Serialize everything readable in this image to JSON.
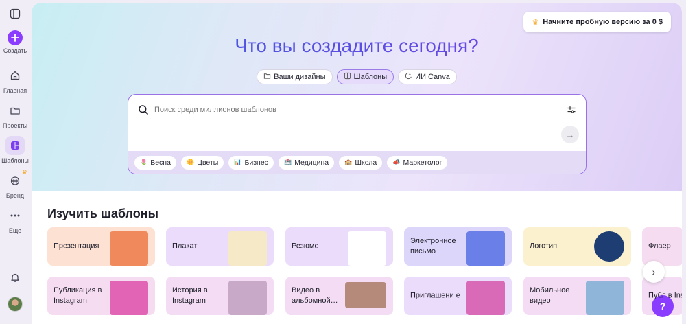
{
  "sidebar": {
    "items": [
      {
        "label": "Создать",
        "icon": "plus-icon"
      },
      {
        "label": "Главная",
        "icon": "home-icon"
      },
      {
        "label": "Проекты",
        "icon": "folder-icon"
      },
      {
        "label": "Шаблоны",
        "icon": "templates-icon"
      },
      {
        "label": "Бренд",
        "icon": "brand-icon"
      },
      {
        "label": "Еще",
        "icon": "more-icon"
      }
    ]
  },
  "header": {
    "trial_label": "Начните пробную версию за 0 $",
    "title": "Что вы создадите сегодня?",
    "tabs": [
      {
        "label": "Ваши дизайны",
        "icon": "folder-icon"
      },
      {
        "label": "Шаблоны",
        "icon": "templates-icon"
      },
      {
        "label": "ИИ Canva",
        "icon": "ai-icon"
      }
    ]
  },
  "search": {
    "placeholder": "Поиск среди миллионов шаблонов",
    "chips": [
      {
        "label": "Весна",
        "emoji": "🌷"
      },
      {
        "label": "Цветы",
        "emoji": "🌼"
      },
      {
        "label": "Бизнес",
        "emoji": "📊"
      },
      {
        "label": "Медицина",
        "emoji": "🏥"
      },
      {
        "label": "Школа",
        "emoji": "🏫"
      },
      {
        "label": "Маркетолог",
        "emoji": "📣"
      }
    ]
  },
  "templates": {
    "title": "Изучить шаблоны",
    "row1": [
      {
        "label": "Презентация",
        "bg": "#fde1d3",
        "art": "#f08a5d"
      },
      {
        "label": "Плакат",
        "bg": "#ecdcfb",
        "art": "#f5e9c8"
      },
      {
        "label": "Резюме",
        "bg": "#ecdcfb",
        "art": "#ffffff"
      },
      {
        "label": "Электронное письмо",
        "bg": "#ddd6fb",
        "art": "#6a7fe8"
      },
      {
        "label": "Логотип",
        "bg": "#fbf1cf",
        "art": "#1e3d72"
      },
      {
        "label": "Флаер",
        "bg": "#f6dcf0",
        "art": "#ffffff"
      }
    ],
    "row2": [
      {
        "label": "Публикация в Instagram",
        "bg": "#f6dcf0",
        "art": "#e264b4"
      },
      {
        "label": "История в Instagram",
        "bg": "#f3dcf4",
        "art": "#c9a9c8"
      },
      {
        "label": "Видео в альбомной…",
        "bg": "#f3dcf4",
        "art": "#b58a7a"
      },
      {
        "label": "Приглашени е",
        "bg": "#ecdcfb",
        "art": "#d96ab8"
      },
      {
        "label": "Мобильное видео",
        "bg": "#f3dcf4",
        "art": "#8fb6d8"
      },
      {
        "label": "Публ в Ins",
        "bg": "#f3dcf4",
        "art": "#ffffff"
      }
    ]
  },
  "help_label": "?",
  "next_label": "›"
}
